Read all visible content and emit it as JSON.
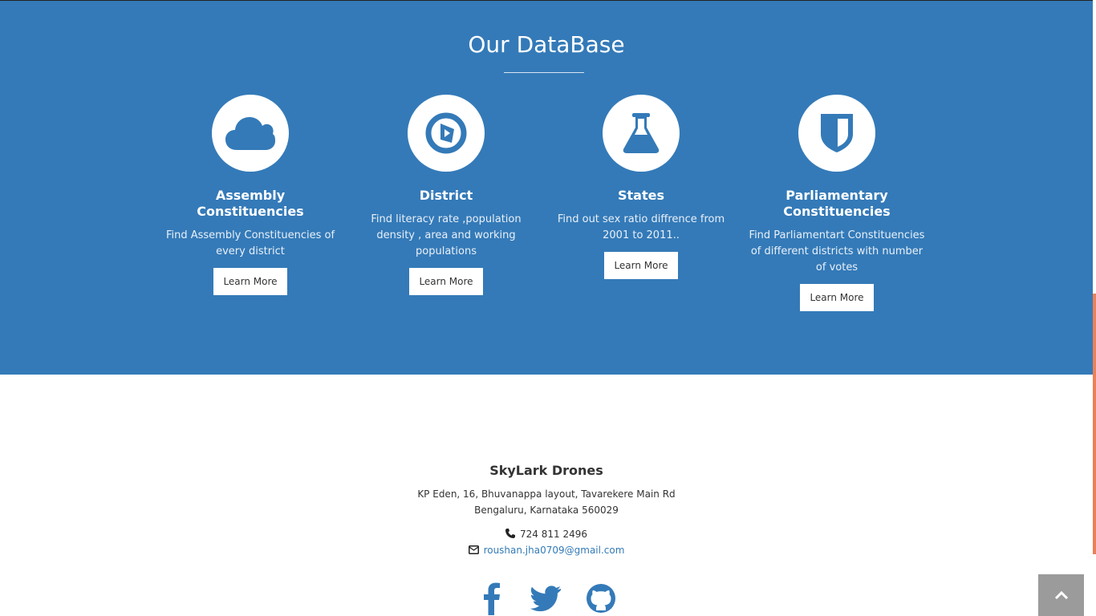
{
  "database": {
    "title": "Our DataBase",
    "cards": [
      {
        "icon": "cloud-icon",
        "title": "Assembly Constituencies",
        "text": "Find Assembly Constituencies of every district",
        "button": "Learn More"
      },
      {
        "icon": "compass-play-icon",
        "title": "District",
        "text": "Find literacy rate ,population density , area and working populations",
        "button": "Learn More"
      },
      {
        "icon": "flask-icon",
        "title": "States",
        "text": "Find out sex ratio diffrence from 2001 to 2011..",
        "button": "Learn More"
      },
      {
        "icon": "shield-icon",
        "title": "Parliamentary Constituencies",
        "text": "Find Parliamentart Constituencies of different districts with number of votes",
        "button": "Learn More"
      }
    ]
  },
  "footer": {
    "company": "SkyLark Drones",
    "address_line1": "KP Eden, 16, Bhuvanappa layout, Tavarekere Main Rd",
    "address_line2": "Bengaluru, Karnataka 560029",
    "phone": "724 811 2496",
    "email": "roushan.jha0709@gmail.com",
    "socials": [
      "facebook-icon",
      "twitter-icon",
      "github-icon"
    ]
  },
  "colors": {
    "section_bg": "#347ab8",
    "link": "#337ab7",
    "scroll_thumb": "#e9825a"
  }
}
